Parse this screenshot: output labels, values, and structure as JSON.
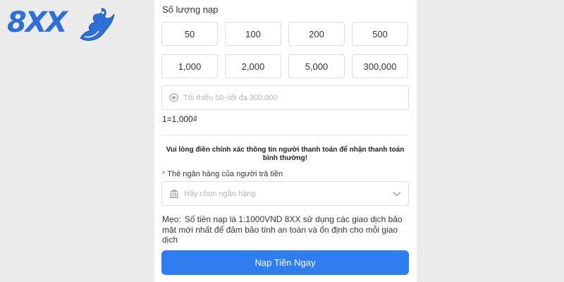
{
  "brand": {
    "logo_text": "8XX",
    "color": "#2f6fd6"
  },
  "form": {
    "amount_section_label": "Số lượng nạp",
    "amount_options": [
      "50",
      "100",
      "200",
      "500",
      "1,000",
      "2,000",
      "5,000",
      "300,000"
    ],
    "amount_placeholder": "Tối thiểu 50~tối đa 300,000",
    "amount_value": "",
    "rate": "1=1,000₫",
    "notice": "Vui lòng điền chính xác thông tin người thanh toán để nhận thanh toán bình thường!",
    "bank_required_mark": "*",
    "bank_label": "Thẻ ngân hàng của người trả tiền",
    "bank_placeholder": "Hãy chọn ngân hàng",
    "tip_label": "Mẹo:",
    "tip_text": "Số tiền nạp là 1:1000VND 8XX sử dụng các giao dịch bảo mật mới nhất để đảm bảo tính an toàn và ổn định cho mỗi giao dịch",
    "submit_label": "Nạp Tiền Ngay"
  },
  "icons": {
    "amount_input": "coin-icon",
    "bank_select": "bank-icon",
    "dropdown": "chevron-down-icon"
  },
  "colors": {
    "primary": "#2f7dee",
    "required": "#e53935",
    "placeholder": "#b5b5b5",
    "background": "#ebebeb",
    "border": "#dcdcdc"
  }
}
